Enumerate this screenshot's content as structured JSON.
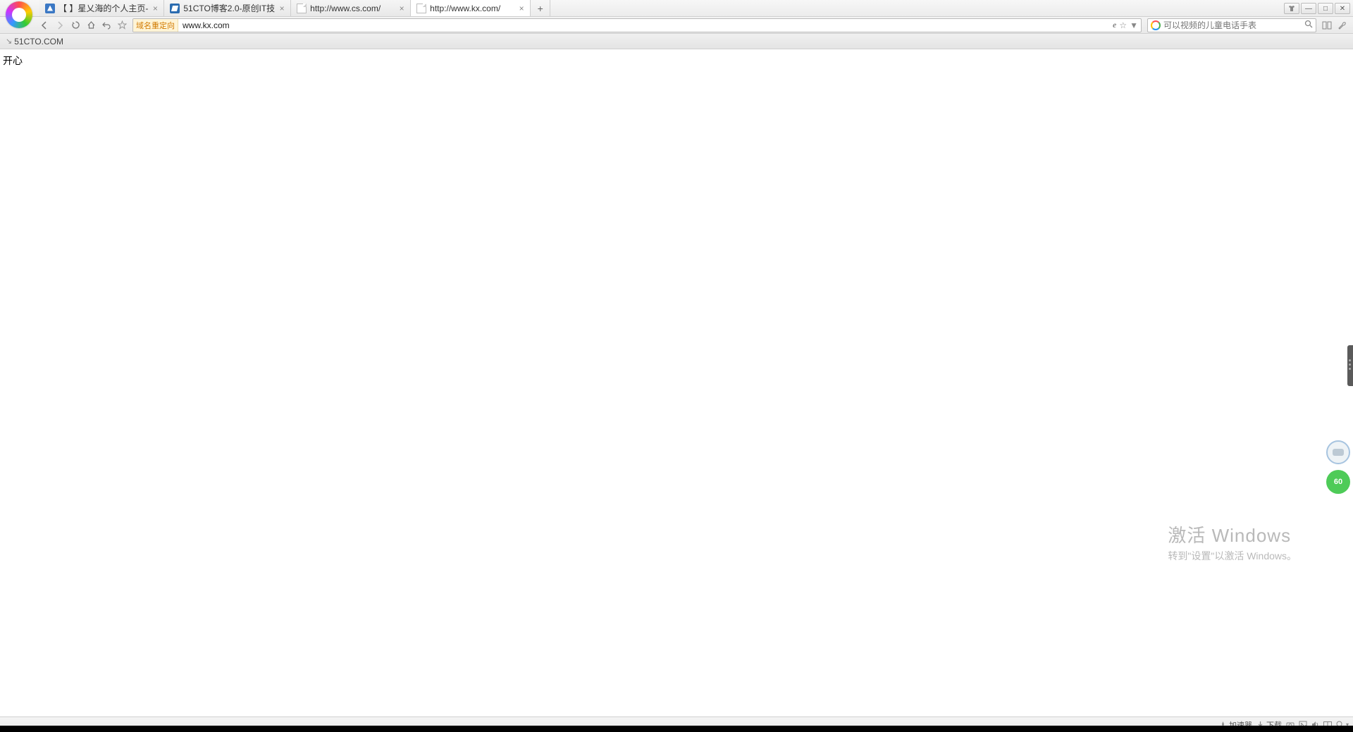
{
  "tabs": [
    {
      "title": "【 】星乂海的个人主页-",
      "favicon": "blue-home"
    },
    {
      "title": "51CTO博客2.0-原创IT技",
      "favicon": "blue-sq"
    },
    {
      "title": "http://www.cs.com/",
      "favicon": "page"
    },
    {
      "title": "http://www.kx.com/",
      "favicon": "page",
      "active": true
    }
  ],
  "address": {
    "redirect_tag": "域名重定向",
    "url": "www.kx.com"
  },
  "search": {
    "placeholder": "可以视频的儿童电话手表"
  },
  "bookmarks": {
    "item0": "51CTO.COM"
  },
  "page": {
    "body_text": "开心"
  },
  "watermark": {
    "line1": "激活 Windows",
    "line2": "转到\"设置\"以激活 Windows。"
  },
  "status": {
    "accel": "加速器",
    "download": "下载"
  },
  "float": {
    "score": "60"
  }
}
